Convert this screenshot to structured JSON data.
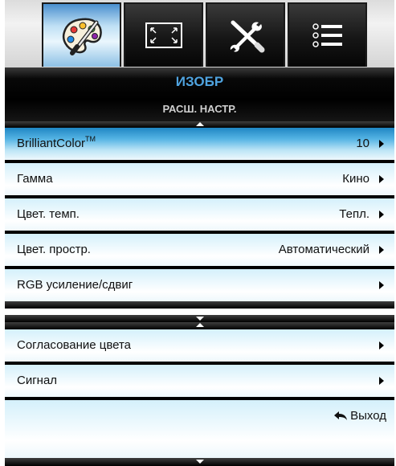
{
  "tabs": [
    {
      "icon": "palette-icon",
      "active": true
    },
    {
      "icon": "screen-frame-icon",
      "active": false
    },
    {
      "icon": "wrench-screwdriver-icon",
      "active": false
    },
    {
      "icon": "options-list-icon",
      "active": false
    }
  ],
  "header": {
    "title": "ИЗОБР",
    "subtitle": "РАСШ. НАСТР."
  },
  "menu_page1": [
    {
      "label": "BrilliantColor",
      "label_sup": "TM",
      "value": "10",
      "selected": true
    },
    {
      "label": "Гамма",
      "value": "Кино"
    },
    {
      "label": "Цвет. темп.",
      "value": "Тепл."
    },
    {
      "label": "Цвет. простр.",
      "value": "Автоматический"
    },
    {
      "label": "RGB усиление/сдвиг",
      "value": ""
    }
  ],
  "menu_page2": [
    {
      "label": "Согласование цвета",
      "value": ""
    },
    {
      "label": "Сигнал",
      "value": ""
    }
  ],
  "exit": {
    "label": "Выход",
    "icon": "return-arrow-icon"
  }
}
